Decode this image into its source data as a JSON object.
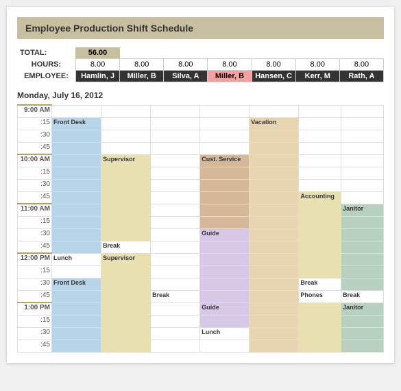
{
  "title": "Employee Production Shift Schedule",
  "summary": {
    "total_label": "TOTAL:",
    "total_value": "56.00",
    "hours_label": "HOURS:",
    "employee_label": "EMPLOYEE:"
  },
  "employees": [
    {
      "name": "Hamlin, J",
      "hours": "8.00",
      "highlight": false
    },
    {
      "name": "Miller, B",
      "hours": "8.00",
      "highlight": false
    },
    {
      "name": "Silva, A",
      "hours": "8.00",
      "highlight": false
    },
    {
      "name": "Miller, B",
      "hours": "8.00",
      "highlight": true
    },
    {
      "name": "Hansen, C",
      "hours": "8.00",
      "highlight": false
    },
    {
      "name": "Kerr, M",
      "hours": "8.00",
      "highlight": false
    },
    {
      "name": "Rath, A",
      "hours": "8.00",
      "highlight": false
    }
  ],
  "date_heading": "Monday, July 16, 2012",
  "time_slots": [
    "9:00 AM",
    ":30",
    ":45",
    "10:00 AM",
    ":15",
    ":30",
    ":45",
    "11:00 AM",
    ":15",
    ":30",
    ":45",
    "12:00 PM",
    ":15",
    ":30",
    ":45",
    "1:00 PM",
    ":15",
    ":30",
    ":45"
  ],
  "cells": {
    "front_desk": "Front Desk",
    "supervisor": "Supervisor",
    "cust_service": "Cust. Service",
    "vacation": "Vacation",
    "accounting": "Accounting",
    "janitor": "Janitor",
    "guide": "Guide",
    "break": "Break",
    "lunch": "Lunch",
    "phones": "Phones"
  }
}
